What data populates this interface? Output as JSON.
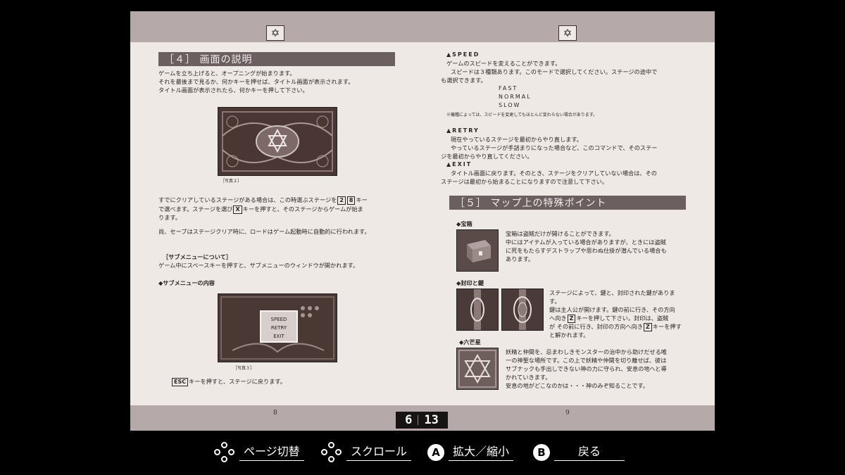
{
  "viewer": {
    "counter_current": "6",
    "counter_total": "13"
  },
  "left_page": {
    "star": "✡",
    "page_number": "8",
    "heading": "［４］ 画面の説明",
    "intro": [
      "ゲームを立ち上げると、オープニングが始まります。",
      "それを最後まで見るか、何かキーを押せば、タイトル画面が表示されます。",
      "タイトル画面が表示されたら、何かキーを押して下さい。"
    ],
    "photo2_caption": "［写真２］",
    "stage_text_1a": "すでにクリアしているステージがある場合は、この時選ぶステージを",
    "stage_key_2": "2",
    "stage_key_8": "8",
    "stage_text_1b": "キー",
    "stage_text_2a": "で選べます。ステージを選び",
    "stage_key_x": "X",
    "stage_text_2b": "キーを押すと、そのステージからゲームが始ま",
    "stage_text_3": "ります。",
    "save_text": "尚、セーブはステージクリア時に、ロードはゲーム起動時に自動的に行われます。",
    "submenu_heading": "［サブメニューについて］",
    "submenu_text": "ゲーム中にスペースキーを押すと、サブメニューのウィンドウが開かれます。",
    "submenu_contents": "◆サブメニューの内容",
    "photo3_caption": "［写真３］",
    "esc_key": "ESC",
    "esc_text": "キーを押すと、ステージに戻ります。",
    "photo3_menu": [
      "SPEED",
      "RETRY",
      "EXIT"
    ]
  },
  "right_page": {
    "star": "✡",
    "page_number": "9",
    "speed_title": "▲SPEED",
    "speed_lines": [
      "ゲームのスピードを変えることができます。",
      "スピードは３種類あります。このモードで選択してください。ステージの途中で",
      "も選択できます。"
    ],
    "speed_options": [
      "FAST",
      "NORMAL",
      "SLOW"
    ],
    "speed_note": "※機種によっては、スピードを変更してもほとんど変わらない場合があります。",
    "retry_title": "▲RETRY",
    "retry_lines": [
      "現在やっているステージを最初からやり直します。",
      "やっているステージが手詰まりになった場合など、このコマンドで、そのステー",
      "ジを最初からやり直してください。"
    ],
    "exit_title": "▲EXIT",
    "exit_lines": [
      "タイトル画面に戻ります。そのとき、ステージをクリアしていない場合は、その",
      "ステージは最初から始まることになりますので注意して下さい。"
    ],
    "heading": "［５］ マップ上の特殊ポイント",
    "treasure_title": "◆宝箱",
    "treasure_lines": [
      "宝箱は盗賊だけが開けることができます。",
      "中にはアイテムが入っている場合がありますが、ときには盗賊",
      "に死をもたらすデストラップや思わぬ仕掛が潜んでいる場合も",
      "あります。"
    ],
    "seal_title": "◆封印と鍵",
    "seal_lines": [
      "ステージによって、鍵と、封印された鍵がありま",
      "す。",
      "鍵は主人公が開けます。鍵の前に行き、その方向",
      "へ向き",
      "キーを押して下さい。封印は、盗賊",
      "が その前に行き、封印の方向へ向き",
      "キーを押す",
      "と解かれます。"
    ],
    "z_key": "Z",
    "hexagram_title": "◆六芒星",
    "hexagram_lines": [
      "妖精と仲間を、忌まわしきモンスターの治中から助けだせる唯",
      "一の神聖な場所です。この上で妖精や仲間を切り離せば、彼は",
      "サブナックも手出しできない神の力に守られ、安息の地へと導",
      "かれていきます。",
      "安息の地がどこなのかは・・・神のみぞ知ることです。"
    ]
  },
  "controls": [
    {
      "icon": "dpad-icon",
      "label": "ページ切替"
    },
    {
      "icon": "dpad-icon",
      "label": "スクロール"
    },
    {
      "icon": "a-button-icon",
      "glyph": "A",
      "label": "拡大／縮小"
    },
    {
      "icon": "b-button-icon",
      "glyph": "B",
      "label": "戻る"
    }
  ]
}
